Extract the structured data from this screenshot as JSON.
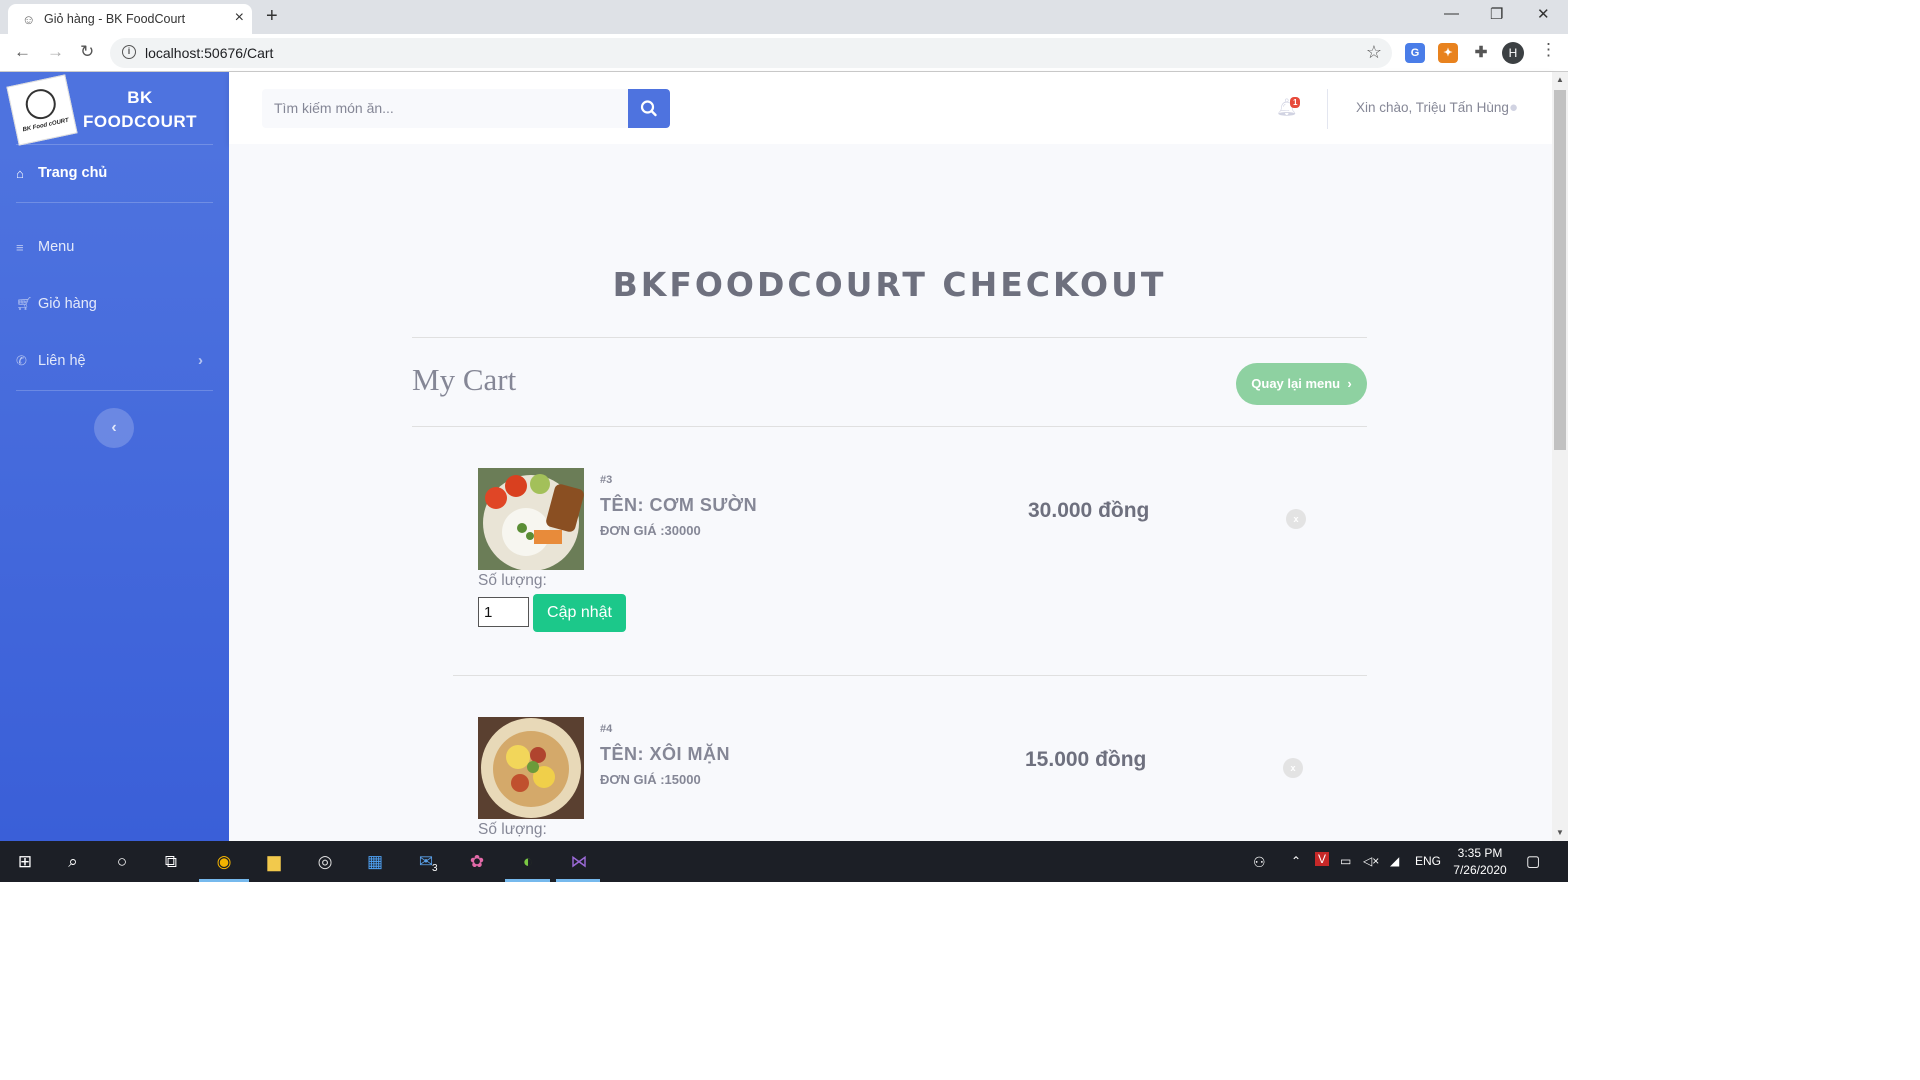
{
  "browser": {
    "tab_title": "Giỏ hàng - BK FoodCourt",
    "url": "localhost:50676/Cart",
    "profile_initial": "H"
  },
  "sidebar": {
    "brand_line1": "BK",
    "brand_line2": "FOODCOURT",
    "logo_text": "BK Food cOURT",
    "items": [
      {
        "label": "Trang chủ",
        "icon": "home-icon"
      },
      {
        "label": "Menu",
        "icon": "bars-icon"
      },
      {
        "label": "Giỏ hàng",
        "icon": "cart-icon"
      },
      {
        "label": "Liên hệ",
        "icon": "phone-icon"
      }
    ]
  },
  "topbar": {
    "search_placeholder": "Tìm kiếm món ăn...",
    "notification_count": "1",
    "greeting": "Xin chào, Triệu Tấn Hùng"
  },
  "main": {
    "checkout_title": "BKFOODCOURT CHECKOUT",
    "cart_heading": "My Cart",
    "back_button": "Quay lại menu",
    "items": [
      {
        "id": "#3",
        "name": "TÊN: CƠM SƯỜN",
        "unit_price": "ĐƠN GIÁ :30000",
        "total": "30.000 đồng",
        "qty_label": "Số lượng:",
        "qty": "1",
        "update_label": "Cập nhật",
        "remove": "x"
      },
      {
        "id": "#4",
        "name": "TÊN: XÔI MẶN",
        "unit_price": "ĐƠN GIÁ :15000",
        "total": "15.000 đồng",
        "qty_label": "Số lượng:",
        "remove": "x"
      }
    ]
  },
  "taskbar": {
    "mail_badge": "3",
    "language": "ENG",
    "time": "3:35 PM",
    "date": "7/26/2020"
  },
  "colors": {
    "sidebar": "#4e73df",
    "primary": "#4e73df",
    "success": "#1cc88a",
    "back_button": "#8ed1a1"
  }
}
